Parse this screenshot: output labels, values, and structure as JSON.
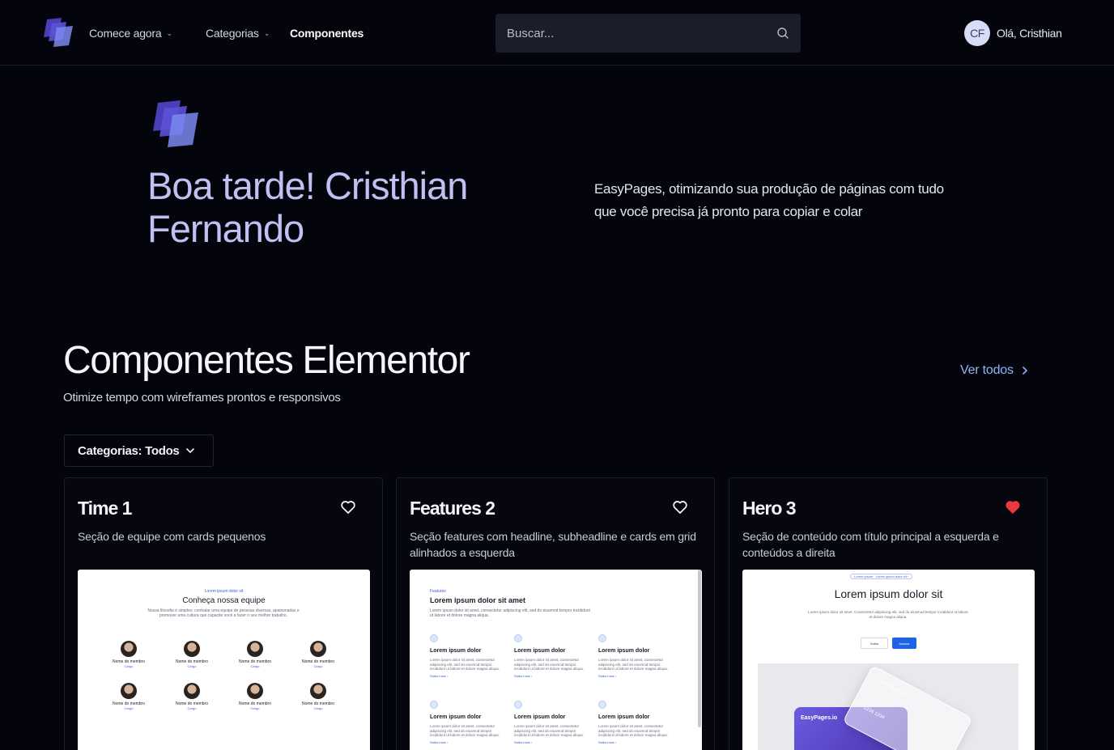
{
  "nav": {
    "items": [
      {
        "label": "Comece agora",
        "has_dropdown": true
      },
      {
        "label": "Categorias",
        "has_dropdown": true
      },
      {
        "label": "Componentes",
        "has_dropdown": false,
        "active": true
      }
    ],
    "search_placeholder": "Buscar...",
    "avatar_initials": "CF",
    "greeting": "Olá, Cristhian"
  },
  "hero": {
    "title": "Boa tarde! Cristhian Fernando",
    "description": "EasyPages, otimizando sua produção de páginas com tudo que você precisa já pronto para copiar e colar"
  },
  "section": {
    "title": "Componentes Elementor",
    "subtitle": "Otimize tempo com wireframes prontos e responsivos",
    "see_all": "Ver todos",
    "filter_label": "Categorias: Todos"
  },
  "cards": [
    {
      "title": "Time 1",
      "description": "Seção de equipe com cards pequenos",
      "favorited": false,
      "preview": {
        "kicker": "Lorem ipsum dolor sit",
        "heading": "Conheça nossa equipe",
        "text": "Nossa filosofia é simples: contratar uma equipe de pessoas diversas, apaixonadas e promover uma cultura que capacite você a fazer o seu melhor trabalho.",
        "members": [
          {
            "name": "Nome do membro",
            "role": "Cargo"
          },
          {
            "name": "Nome do membro",
            "role": "Cargo"
          },
          {
            "name": "Nome do membro",
            "role": "Cargo"
          },
          {
            "name": "Nome do membro",
            "role": "Cargo"
          },
          {
            "name": "Nome do membro",
            "role": "Cargo"
          },
          {
            "name": "Nome do membro",
            "role": "Cargo"
          },
          {
            "name": "Nome do membro",
            "role": "Cargo"
          },
          {
            "name": "Nome do membro",
            "role": "Cargo"
          }
        ]
      }
    },
    {
      "title": "Features 2",
      "description": "Seção features com headline, subheadline e cards em grid alinhados a esquerda",
      "favorited": false,
      "preview": {
        "kicker": "Features",
        "heading": "Lorem ipsum dolor sit amet",
        "text": "Lorem ipsum dolor sit amet, consectetur adipiscing elit, sed do eiusmod tempor incididunt ut labore et dolore magna aliqua.",
        "feature_title": "Lorem ipsum dolor",
        "feature_text": "Lorem ipsum dolor sit amet, consectetur adipiscing elit, sed do eiusmod tempor incididunt ut labore et dolore magna aliqua.",
        "feature_link": "Saiba mais ›"
      }
    },
    {
      "title": "Hero 3",
      "description": "Seção de conteúdo com título principal a esquerda e conteúdos a direita",
      "favorited": true,
      "preview": {
        "badge": "Lorem ipsum · Lorem ipsum dolor sit ›",
        "heading": "Lorem ipsum dolor sit",
        "text": "Lorem ipsum dolor sit amet. Consectetur adipiscing elit, sed do eiusmod tempor incididunt ut labore et dolore magna aliqua.",
        "button_secondary": "Saiba",
        "button_primary": "Assinar",
        "card_brand": "EasyPages.io",
        "card_glass_brand": "EasyPages.io",
        "card_glass_text": "1234 1234"
      }
    }
  ],
  "colors": {
    "background": "#03040c",
    "accent_purple": "#c3bff2",
    "link_blue": "#8fb5f2",
    "heart_red": "#e9383f"
  },
  "icons": {
    "logo": "stacked-layers-logo",
    "search": "search-icon",
    "chevron": "chevron-down-icon",
    "favorite": "heart-icon"
  }
}
